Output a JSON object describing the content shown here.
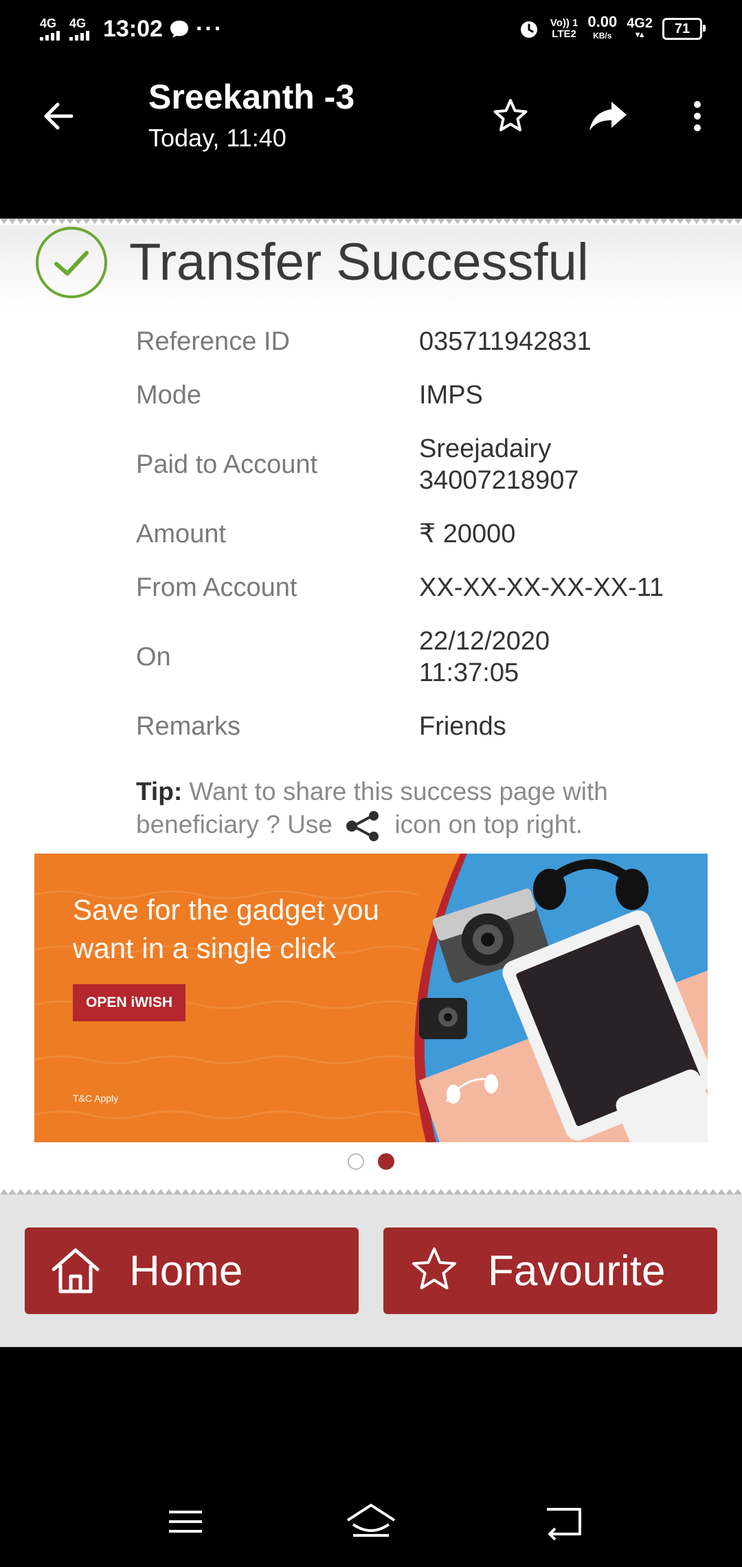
{
  "status_bar": {
    "network_1": "4G",
    "network_2": "4G",
    "time": "13:02",
    "volte": "Vo)) 1",
    "lte": "LTE2",
    "speed_value": "0.00",
    "speed_unit": "KB/s",
    "network_3": "4G2",
    "battery": "71"
  },
  "app_bar": {
    "title": "Sreekanth -3",
    "subtitle": "Today, 11:40"
  },
  "receipt": {
    "heading": "Transfer Successful",
    "rows": [
      {
        "label": "Reference ID",
        "value": "035711942831"
      },
      {
        "label": "Mode",
        "value": "IMPS"
      },
      {
        "label": "Paid to Account",
        "value_line1": "Sreejadairy",
        "value_line2": "34007218907"
      },
      {
        "label": "Amount",
        "value": "₹ 20000"
      },
      {
        "label": "From Account",
        "value": "XX-XX-XX-XX-XX-11"
      },
      {
        "label": "On",
        "value_line1": "22/12/2020",
        "value_line2": "11:37:05"
      },
      {
        "label": "Remarks",
        "value": "Friends"
      }
    ],
    "tip_label": "Tip:",
    "tip_text_1": "Want to share this success page with beneficiary ? Use",
    "tip_text_2": "icon on top right."
  },
  "banner": {
    "text": "Save for the gadget you want in a single click",
    "button_label": "OPEN iWISH",
    "terms": "T&C Apply"
  },
  "footer": {
    "home_label": "Home",
    "favourite_label": "Favourite"
  },
  "colors": {
    "brand_red": "#a0292b",
    "banner_orange": "#ee7c24",
    "success_green": "#6aa832"
  },
  "icons": {
    "back": "arrow-left-icon",
    "star": "star-icon",
    "share": "forward-icon",
    "more": "more-vertical-icon",
    "success": "check-circle-icon",
    "share_inline": "share-icon",
    "home": "home-icon",
    "favourite": "star-outline-icon"
  }
}
